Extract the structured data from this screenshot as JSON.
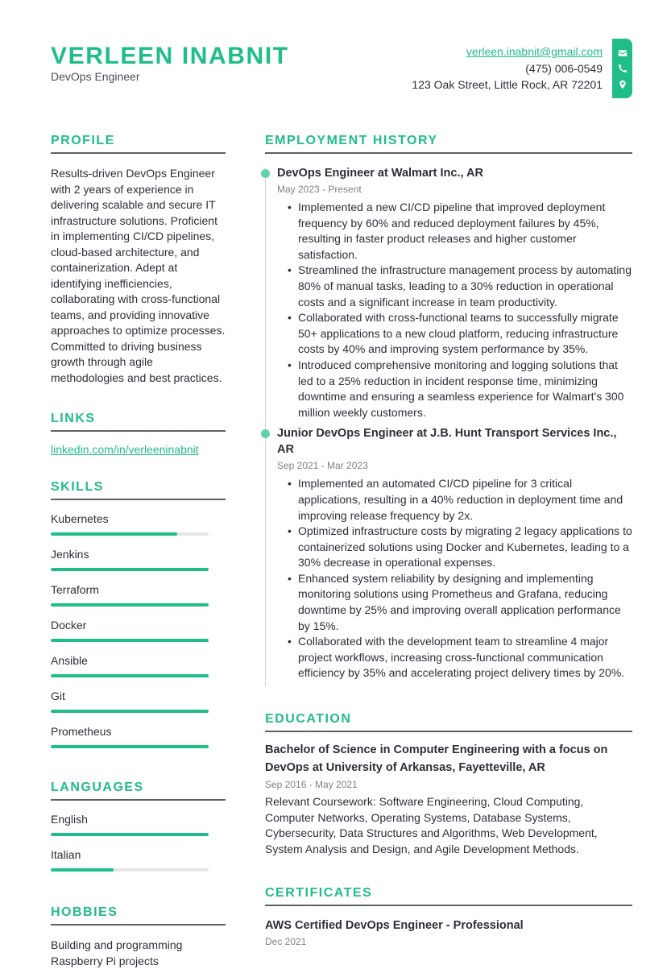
{
  "header": {
    "name": "VERLEEN INABNIT",
    "role": "DevOps Engineer"
  },
  "contact": {
    "email": "verleen.inabnit@gmail.com",
    "phone": "(475) 006-0549",
    "address": "123 Oak Street, Little Rock, AR 72201",
    "icons": [
      "envelope-icon",
      "phone-icon",
      "map-pin-icon"
    ],
    "accent_color": "#1fbd87"
  },
  "profile": {
    "title": "PROFILE",
    "text": "Results-driven DevOps Engineer with 2 years of experience in delivering scalable and secure IT infrastructure solutions. Proficient in implementing CI/CD pipelines, cloud-based architecture, and containerization. Adept at identifying inefficiencies, collaborating with cross-functional teams, and providing innovative approaches to optimize processes. Committed to driving business growth through agile methodologies and best practices."
  },
  "links": {
    "title": "LINKS",
    "items": [
      {
        "label": "linkedin.com/in/verleeninabnit"
      }
    ]
  },
  "skills": {
    "title": "SKILLS",
    "items": [
      {
        "name": "Kubernetes",
        "level": 0.8
      },
      {
        "name": "Jenkins",
        "level": 1.0
      },
      {
        "name": "Terraform",
        "level": 1.0
      },
      {
        "name": "Docker",
        "level": 1.0
      },
      {
        "name": "Ansible",
        "level": 1.0
      },
      {
        "name": "Git",
        "level": 1.0
      },
      {
        "name": "Prometheus",
        "level": 1.0
      }
    ]
  },
  "languages": {
    "title": "LANGUAGES",
    "items": [
      {
        "name": "English",
        "level": 1.0
      },
      {
        "name": "Italian",
        "level": 0.4
      }
    ]
  },
  "hobbies": {
    "title": "HOBBIES",
    "text": "Building and programming Raspberry Pi projects"
  },
  "employment": {
    "title": "EMPLOYMENT HISTORY",
    "jobs": [
      {
        "title": "DevOps Engineer at Walmart Inc., AR",
        "dates": "May 2023 - Present",
        "bullets": [
          "Implemented a new CI/CD pipeline that improved deployment frequency by 60% and reduced deployment failures by 45%, resulting in faster product releases and higher customer satisfaction.",
          "Streamlined the infrastructure management process by automating 80% of manual tasks, leading to a 30% reduction in operational costs and a significant increase in team productivity.",
          "Collaborated with cross-functional teams to successfully migrate 50+ applications to a new cloud platform, reducing infrastructure costs by 40% and improving system performance by 35%.",
          "Introduced comprehensive monitoring and logging solutions that led to a 25% reduction in incident response time, minimizing downtime and ensuring a seamless experience for Walmart's 300 million weekly customers."
        ]
      },
      {
        "title": "Junior DevOps Engineer at J.B. Hunt Transport Services Inc., AR",
        "dates": "Sep 2021 - Mar 2023",
        "bullets": [
          "Implemented an automated CI/CD pipeline for 3 critical applications, resulting in a 40% reduction in deployment time and improving release frequency by 2x.",
          "Optimized infrastructure costs by migrating 2 legacy applications to containerized solutions using Docker and Kubernetes, leading to a 30% decrease in operational expenses.",
          "Enhanced system reliability by designing and implementing monitoring solutions using Prometheus and Grafana, reducing downtime by 25% and improving overall application performance by 15%.",
          "Collaborated with the development team to streamline 4 major project workflows, increasing cross-functional communication efficiency by 35% and accelerating project delivery times by 20%."
        ]
      }
    ]
  },
  "education": {
    "title": "EDUCATION",
    "degree": "Bachelor of Science in Computer Engineering with a focus on DevOps at University of Arkansas, Fayetteville, AR",
    "dates": "Sep 2016 - May 2021",
    "text": "Relevant Coursework: Software Engineering, Cloud Computing, Computer Networks, Operating Systems, Database Systems, Cybersecurity, Data Structures and Algorithms, Web Development, System Analysis and Design, and Agile Development Methods."
  },
  "certificates": {
    "title": "CERTIFICATES",
    "items": [
      {
        "title": "AWS Certified DevOps Engineer - Professional",
        "date": "Dec 2021"
      }
    ]
  }
}
